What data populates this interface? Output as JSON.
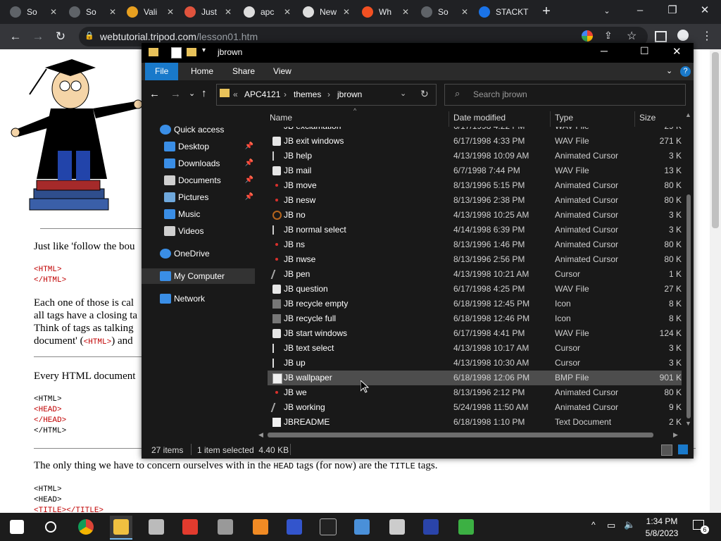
{
  "browser": {
    "tabs": [
      {
        "title": "So",
        "icon": "gear-icon",
        "color": "#5f6368"
      },
      {
        "title": "So",
        "icon": "gear-icon",
        "color": "#5f6368"
      },
      {
        "title": "Vali",
        "icon": "v-logo-icon",
        "color": "#e8a020"
      },
      {
        "title": "Just",
        "icon": "anvil-icon",
        "color": "#e0533d"
      },
      {
        "title": "apc",
        "icon": "library-icon",
        "color": "#dddddd"
      },
      {
        "title": "New",
        "icon": "chrome-icon",
        "color": "#dddddd"
      },
      {
        "title": "Wh",
        "icon": "microsoft-icon",
        "color": "#f25022"
      },
      {
        "title": "So",
        "icon": "gear-icon",
        "color": "#5f6368"
      },
      {
        "title": "STACKT",
        "icon": "stack-icon",
        "color": "#1a73e8"
      }
    ],
    "url_domain": "webtutorial.tripod.com",
    "url_path": "/lesson01.htm"
  },
  "webpage": {
    "para1": "Just like 'follow the bou",
    "code1": [
      "<HTML>",
      "</HTML>"
    ],
    "para2_lines": [
      "Each one of those is cal",
      "all tags have a closing ta",
      "Think of tags as talking",
      "document' ("
    ],
    "para2_tag": "<HTML>",
    "para2_end": ") and",
    "para3": "Every HTML document",
    "code2": [
      "<HTML>",
      "<HEAD>",
      "</HEAD>",
      "</HTML>"
    ],
    "para4_a": "The only thing we have to concern ourselves with in the ",
    "para4_head": "HEAD",
    "para4_b": " tags (for now) are the ",
    "para4_title": "TITLE",
    "para4_c": " tags.",
    "code3": [
      "<HTML>",
      "<HEAD>",
      "<TITLE></TITLE>"
    ]
  },
  "explorer": {
    "title": "jbrown",
    "ribbon_tabs": [
      "File",
      "Home",
      "Share",
      "View"
    ],
    "breadcrumb": [
      "APC4121",
      "themes",
      "jbrown"
    ],
    "search_placeholder": "Search jbrown",
    "nav": [
      {
        "label": "Quick access",
        "icon": "star-icon",
        "pinned": false
      },
      {
        "label": "Desktop",
        "icon": "desktop-icon",
        "pinned": true
      },
      {
        "label": "Downloads",
        "icon": "download-icon",
        "pinned": true
      },
      {
        "label": "Documents",
        "icon": "documents-icon",
        "pinned": true
      },
      {
        "label": "Pictures",
        "icon": "pictures-icon",
        "pinned": true
      },
      {
        "label": "Music",
        "icon": "music-icon",
        "pinned": false
      },
      {
        "label": "Videos",
        "icon": "videos-icon",
        "pinned": false
      },
      {
        "label": "OneDrive",
        "icon": "cloud-icon",
        "pinned": false
      },
      {
        "label": "My Computer",
        "icon": "computer-icon",
        "pinned": false
      },
      {
        "label": "Network",
        "icon": "network-icon",
        "pinned": false
      }
    ],
    "columns": [
      "Name",
      "Date modified",
      "Type",
      "Size"
    ],
    "partial_row": {
      "name": "JB exclamation",
      "date": "6/17/1998 4:22 PM",
      "type": "WAV File",
      "size": "29 K"
    },
    "files": [
      {
        "name": "JB exit windows",
        "date": "6/17/1998 4:33 PM",
        "type": "WAV File",
        "size": "271 K",
        "icon": "wav"
      },
      {
        "name": "JB help",
        "date": "4/13/1998 10:09 AM",
        "type": "Animated Cursor",
        "size": "3 K",
        "icon": "cursor"
      },
      {
        "name": "JB mail",
        "date": "6/7/1998 7:44 PM",
        "type": "WAV File",
        "size": "13 K",
        "icon": "wav"
      },
      {
        "name": "JB move",
        "date": "8/13/1996 5:15 PM",
        "type": "Animated Cursor",
        "size": "80 K",
        "icon": "dot"
      },
      {
        "name": "JB nesw",
        "date": "8/13/1996 2:38 PM",
        "type": "Animated Cursor",
        "size": "80 K",
        "icon": "dot"
      },
      {
        "name": "JB no",
        "date": "4/13/1998 10:25 AM",
        "type": "Animated Cursor",
        "size": "3 K",
        "icon": "no"
      },
      {
        "name": "JB normal select",
        "date": "4/14/1998 6:39 PM",
        "type": "Animated Cursor",
        "size": "3 K",
        "icon": "cursor"
      },
      {
        "name": "JB ns",
        "date": "8/13/1996 1:46 PM",
        "type": "Animated Cursor",
        "size": "80 K",
        "icon": "dot"
      },
      {
        "name": "JB nwse",
        "date": "8/13/1996 2:56 PM",
        "type": "Animated Cursor",
        "size": "80 K",
        "icon": "dot"
      },
      {
        "name": "JB pen",
        "date": "4/13/1998 10:21 AM",
        "type": "Cursor",
        "size": "1 K",
        "icon": "pen"
      },
      {
        "name": "JB question",
        "date": "6/17/1998 4:25 PM",
        "type": "WAV File",
        "size": "27 K",
        "icon": "wav"
      },
      {
        "name": "JB recycle empty",
        "date": "6/18/1998 12:45 PM",
        "type": "Icon",
        "size": "8 K",
        "icon": "img"
      },
      {
        "name": "JB recycle full",
        "date": "6/18/1998 12:46 PM",
        "type": "Icon",
        "size": "8 K",
        "icon": "img"
      },
      {
        "name": "JB start windows",
        "date": "6/17/1998 4:41 PM",
        "type": "WAV File",
        "size": "124 K",
        "icon": "wav"
      },
      {
        "name": "JB text select",
        "date": "4/13/1998 10:17 AM",
        "type": "Cursor",
        "size": "3 K",
        "icon": "text"
      },
      {
        "name": "JB up",
        "date": "4/13/1998 10:30 AM",
        "type": "Cursor",
        "size": "3 K",
        "icon": "text"
      },
      {
        "name": "JB wallpaper",
        "date": "6/18/1998 12:06 PM",
        "type": "BMP File",
        "size": "901 K",
        "icon": "bmp",
        "selected": true
      },
      {
        "name": "JB we",
        "date": "8/13/1996 2:12 PM",
        "type": "Animated Cursor",
        "size": "80 K",
        "icon": "dot"
      },
      {
        "name": "JB working",
        "date": "5/24/1998 11:50 AM",
        "type": "Animated Cursor",
        "size": "9 K",
        "icon": "pen"
      },
      {
        "name": "JBREADME",
        "date": "6/18/1998 1:10 PM",
        "type": "Text Document",
        "size": "2 K",
        "icon": "txt"
      }
    ],
    "status_items": "27 items",
    "status_selected": "1 item selected  4.40 KB"
  },
  "taskbar": {
    "icons": [
      "windows-start-icon",
      "search-icon",
      "chrome-icon",
      "file-explorer-icon",
      "app-icon-1",
      "app-icon-2",
      "app-icon-3",
      "app-icon-4",
      "ftp-icon",
      "terminal-icon",
      "photo-icon",
      "app-icon-5",
      "app-icon-6",
      "recycle-icon"
    ],
    "time": "1:34 PM",
    "date": "5/8/2023"
  }
}
